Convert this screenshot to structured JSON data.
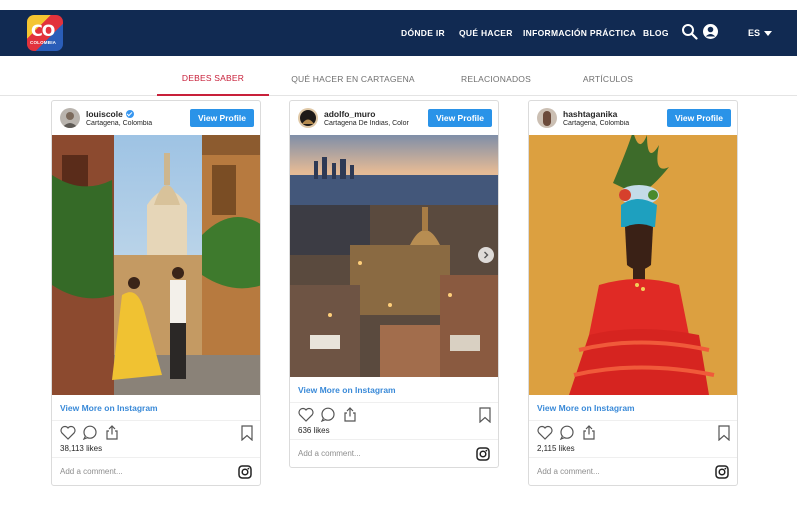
{
  "header": {
    "logo": {
      "text": "CO",
      "subtext": "COLOMBIA"
    },
    "nav": [
      "DÓNDE IR",
      "QUÉ HACER",
      "INFORMACIÓN PRÁCTICA",
      "BLOG"
    ],
    "search_icon": "search-icon",
    "account_icon": "user-circle-icon",
    "language": "ES"
  },
  "tabs": [
    {
      "label": "DEBES SABER",
      "active": true
    },
    {
      "label": "QUÉ HACER EN CARTAGENA",
      "active": false
    },
    {
      "label": "RELACIONADOS",
      "active": false
    },
    {
      "label": "ARTÍCULOS",
      "active": false
    }
  ],
  "cards": [
    {
      "username": "louiscole",
      "verified": true,
      "location": "Cartagena, Colombia",
      "button": "View Profile",
      "more": "View More on Instagram",
      "likes": "38,113 likes",
      "comment_placeholder": "Add a comment..."
    },
    {
      "username": "adolfo_muro",
      "verified": false,
      "location": "Cartagena De Indias, Color",
      "button": "View Profile",
      "more": "View More on Instagram",
      "likes": "636 likes",
      "comment_placeholder": "Add a comment..."
    },
    {
      "username": "hashtaganika",
      "verified": false,
      "location": "Cartagena, Colombia",
      "button": "View Profile",
      "more": "View More on Instagram",
      "likes": "2,115 likes",
      "comment_placeholder": "Add a comment..."
    }
  ],
  "colors": {
    "header_bg": "#112a52",
    "active_tab": "#c8203a",
    "profile_button": "#2a93e8",
    "link": "#3a8ad8"
  }
}
